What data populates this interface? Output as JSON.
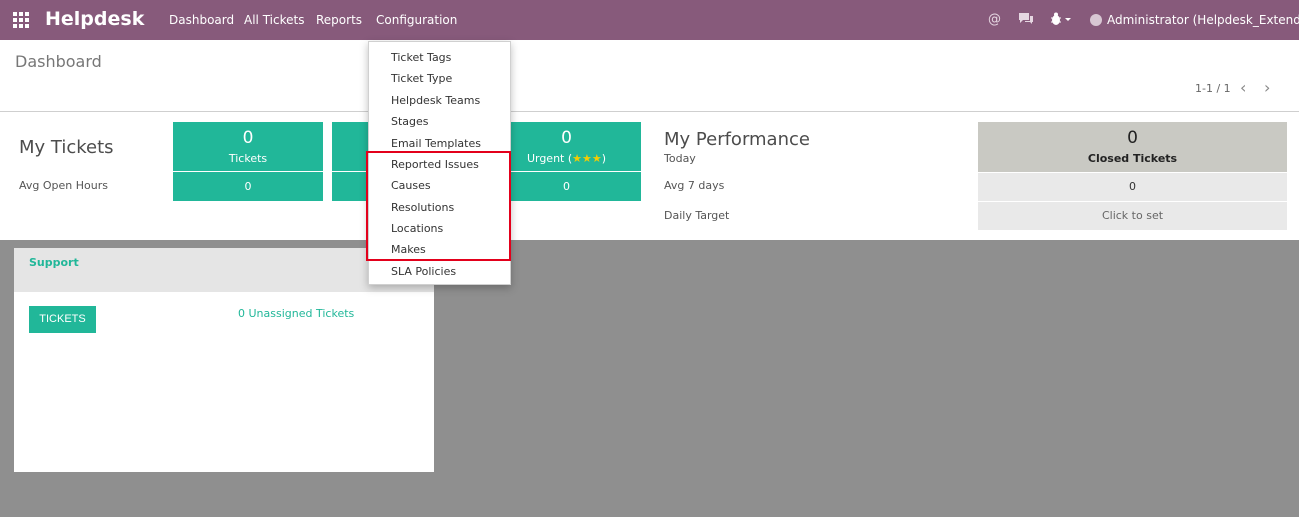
{
  "navbar": {
    "brand": "Helpdesk",
    "menu": [
      "Dashboard",
      "All Tickets",
      "Reports",
      "Configuration"
    ],
    "user": "Administrator (Helpdesk_Extend)",
    "icons": [
      "apps-grid-icon",
      "at-icon",
      "chat-icon",
      "bug-icon",
      "user-avatar"
    ]
  },
  "control_panel": {
    "breadcrumb": "Dashboard",
    "pager": "1-1 / 1"
  },
  "my_tickets": {
    "title": "My Tickets",
    "avg_label": "Avg Open Hours",
    "tiles": [
      {
        "value": "0",
        "label": "Tickets",
        "avg": "0"
      },
      {
        "value": "0",
        "label": "Urgent",
        "avg": "0"
      }
    ],
    "urgent_stars": "★★★"
  },
  "my_performance": {
    "title": "My Performance",
    "today": "Today",
    "avg7": "Avg 7 days",
    "daily_target": "Daily Target",
    "closed_value": "0",
    "closed_label": "Closed Tickets",
    "avg7_value": "0",
    "target_action": "Click to set"
  },
  "team": {
    "name": "Support",
    "button": "TICKETS",
    "unassigned": "0 Unassigned Tickets"
  },
  "config_menu": {
    "items": [
      "Ticket Tags",
      "Ticket Type",
      "Helpdesk Teams",
      "Stages",
      "Email Templates",
      "Reported Issues",
      "Causes",
      "Resolutions",
      "Locations",
      "Makes",
      "SLA Policies"
    ]
  },
  "colors": {
    "navbar": "#875a7b",
    "accent": "#21b799",
    "highlight_box": "#e3001b"
  }
}
